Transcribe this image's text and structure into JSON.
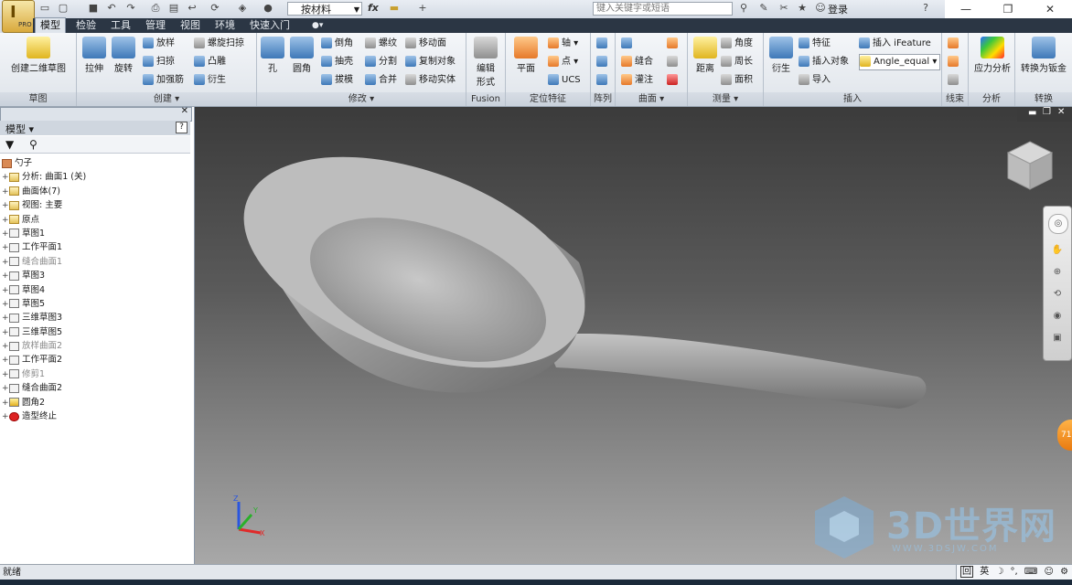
{
  "titlebar": {
    "material": "按材料",
    "fx": "fx",
    "search_placeholder": "键入关键字或短语",
    "login": "登录"
  },
  "appbutton": {
    "pro": "PRO"
  },
  "tabs": [
    "模型",
    "检验",
    "工具",
    "管理",
    "视图",
    "环境",
    "快速入门"
  ],
  "ribbon": {
    "panels": {
      "sketch": {
        "label": "草图",
        "create_sketch": "创建二维草图"
      },
      "create": {
        "label": "创建",
        "extrude": "拉伸",
        "revolve": "旋转",
        "loft": "放样",
        "sweep": "扫掠",
        "rib": "加强筋",
        "coil": "螺旋扫掠",
        "emboss": "凸雕",
        "derive": "衍生"
      },
      "modify": {
        "label": "修改",
        "hole": "孔",
        "fillet": "圆角",
        "chamfer": "倒角",
        "shell": "抽壳",
        "draft": "拔模",
        "thread": "螺纹",
        "split": "分割",
        "combine": "合并",
        "move_face": "移动面",
        "copy_object": "复制对象",
        "move_body": "移动实体"
      },
      "fusion": {
        "label": "Fusion",
        "edit_form": "编辑",
        "edit_form2": "形式"
      },
      "workfeatures": {
        "label": "定位特征",
        "plane": "平面",
        "axis": "轴",
        "point": "点",
        "ucs": "UCS"
      },
      "pattern": {
        "label": "阵列"
      },
      "surface": {
        "label": "曲面",
        "stitch": "缝合",
        "patch": "灌注"
      },
      "measure": {
        "label": "测量",
        "distance": "距离",
        "angle": "角度",
        "loop": "周长",
        "area": "面积"
      },
      "insert": {
        "label": "插入",
        "derive": "衍生",
        "feature": "特征",
        "insert_object": "插入对象",
        "import": "导入",
        "insert_ifeature": "插入 iFeature",
        "angle_equal": "Angle_equal"
      },
      "constrain": {
        "label": "线束"
      },
      "analysis": {
        "label": "分析",
        "stress": "应力分析"
      },
      "convert": {
        "label": "转换",
        "to_sheetmetal": "转换为钣金"
      }
    }
  },
  "browser": {
    "title": "模型",
    "root": "勺子",
    "items": [
      {
        "label": "分析: 曲面1 (关)",
        "dim": false
      },
      {
        "label": "曲面体(7)",
        "dim": false
      },
      {
        "label": "视图: 主要",
        "dim": false
      },
      {
        "label": "原点",
        "dim": false
      },
      {
        "label": "草图1",
        "dim": false
      },
      {
        "label": "工作平面1",
        "dim": false
      },
      {
        "label": "缝合曲面1",
        "dim": true
      },
      {
        "label": "草图3",
        "dim": false
      },
      {
        "label": "草图4",
        "dim": false
      },
      {
        "label": "草图5",
        "dim": false
      },
      {
        "label": "三维草图3",
        "dim": false
      },
      {
        "label": "三维草图5",
        "dim": false
      },
      {
        "label": "放样曲面2",
        "dim": true
      },
      {
        "label": "工作平面2",
        "dim": false
      },
      {
        "label": "修剪1",
        "dim": true
      },
      {
        "label": "缝合曲面2",
        "dim": false
      },
      {
        "label": "圆角2",
        "dim": false
      },
      {
        "label": "造型终止",
        "dim": false
      }
    ]
  },
  "viewport": {
    "bubble": "71",
    "watermark": {
      "brand": "3D世界网",
      "url": "WWW.3DSJW.COM"
    }
  },
  "statusbar": {
    "status": "就绪",
    "ime": "英"
  }
}
